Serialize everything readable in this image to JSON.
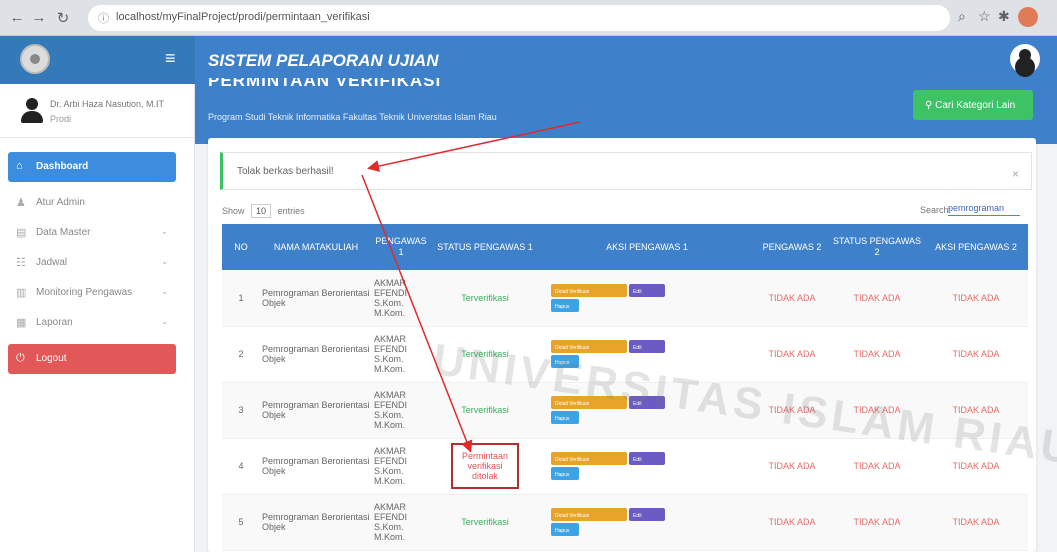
{
  "browser": {
    "url": "localhost/myFinalProject/prodi/permintaan_verifikasi"
  },
  "app": {
    "title": "SISTEM PELAPORAN UJIAN"
  },
  "profile": {
    "name": "Dr. Arbi Haza Nasution, M.IT",
    "role": "Prodi"
  },
  "sidebar": {
    "items": [
      {
        "label": "Dashboard",
        "icon": "home-icon"
      },
      {
        "label": "Atur Admin",
        "icon": "user-icon"
      },
      {
        "label": "Data Master",
        "icon": "table-icon"
      },
      {
        "label": "Jadwal",
        "icon": "calendar-icon"
      },
      {
        "label": "Monitoring Pengawas",
        "icon": "monitor-icon"
      },
      {
        "label": "Laporan",
        "icon": "report-icon"
      },
      {
        "label": "Logout",
        "icon": "power-icon"
      }
    ]
  },
  "page": {
    "title": "PERMINTAAN VERIFIKASI",
    "subtitle": "Program Studi Teknik Informatika Fakultas Teknik Universitas Islam Riau",
    "cari_button": "Cari Kategori Lain"
  },
  "alert": {
    "text": "Tolak berkas berhasil!"
  },
  "table_controls": {
    "show_label": "Show",
    "show_value": "10",
    "entries_label": "entries",
    "search_label": "Search:",
    "search_value": "pemrograman"
  },
  "table": {
    "headers": [
      "NO",
      "NAMA MATAKULIAH",
      "PENGAWAS 1",
      "STATUS PENGAWAS 1",
      "AKSI PENGAWAS 1",
      "PENGAWAS 2",
      "STATUS PENGAWAS 2",
      "AKSI PENGAWAS 2"
    ],
    "rows": [
      {
        "no": "1",
        "matkul": "Pemrograman Berorientasi Objek",
        "pengawas1": "AKMAR EFENDI S.Kom. M.Kom.",
        "status1": "Terverifikasi",
        "pengawas2": "TIDAK ADA",
        "status2": "TIDAK ADA",
        "aksi2": "TIDAK ADA"
      },
      {
        "no": "2",
        "matkul": "Pemrograman Berorientasi Objek",
        "pengawas1": "AKMAR EFENDI S.Kom. M.Kom.",
        "status1": "Terverifikasi",
        "pengawas2": "TIDAK ADA",
        "status2": "TIDAK ADA",
        "aksi2": "TIDAK ADA"
      },
      {
        "no": "3",
        "matkul": "Pemrograman Berorientasi Objek",
        "pengawas1": "AKMAR EFENDI S.Kom. M.Kom.",
        "status1": "Terverifikasi",
        "pengawas2": "TIDAK ADA",
        "status2": "TIDAK ADA",
        "aksi2": "TIDAK ADA"
      },
      {
        "no": "4",
        "matkul": "Pemrograman Berorientasi Objek",
        "pengawas1": "AKMAR EFENDI S.Kom. M.Kom.",
        "status1": "Permintaan verifikasi ditolak",
        "pengawas2": "TIDAK ADA",
        "status2": "TIDAK ADA",
        "aksi2": "TIDAK ADA"
      },
      {
        "no": "5",
        "matkul": "Pemrograman Berorientasi Objek",
        "pengawas1": "AKMAR EFENDI S.Kom. M.Kom.",
        "status1": "Terverifikasi",
        "pengawas2": "TIDAK ADA",
        "status2": "TIDAK ADA",
        "aksi2": "TIDAK ADA"
      }
    ],
    "action_labels": {
      "detail": "Detail Verifikasi",
      "edit": "Edit",
      "hapus": "Hapus"
    }
  },
  "watermark": "UNIVERSITAS ISLAM RIAU",
  "colors": {
    "header_blue": "#3e80c9",
    "verified_green": "#2fb557",
    "tidak_red": "#ea6a6a",
    "annotation_red": "#e02b2b"
  }
}
